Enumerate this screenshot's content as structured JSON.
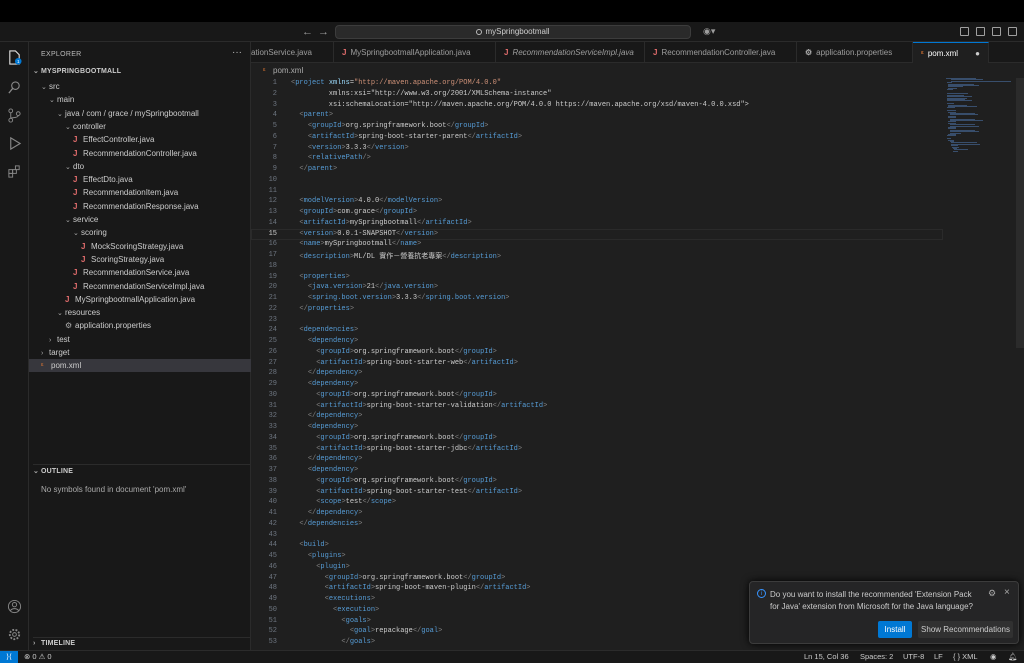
{
  "titlebar": {
    "search": "mySpringbootmall"
  },
  "explorer": {
    "header": "EXPLORER",
    "project": "MYSPRINGBOOTMALL",
    "tree": [
      {
        "label": "src",
        "indent": 1,
        "kind": "folder-open"
      },
      {
        "label": "main",
        "indent": 2,
        "kind": "folder-open"
      },
      {
        "label": "java / com / grace / mySpringbootmall",
        "indent": 3,
        "kind": "folder-open"
      },
      {
        "label": "controller",
        "indent": 4,
        "kind": "folder-open"
      },
      {
        "label": "EffectController.java",
        "indent": 5,
        "kind": "java"
      },
      {
        "label": "RecommendationController.java",
        "indent": 5,
        "kind": "java"
      },
      {
        "label": "dto",
        "indent": 4,
        "kind": "folder-open"
      },
      {
        "label": "EffectDto.java",
        "indent": 5,
        "kind": "java"
      },
      {
        "label": "RecommendationItem.java",
        "indent": 5,
        "kind": "java"
      },
      {
        "label": "RecommendationResponse.java",
        "indent": 5,
        "kind": "java"
      },
      {
        "label": "service",
        "indent": 4,
        "kind": "folder-open"
      },
      {
        "label": "scoring",
        "indent": 5,
        "kind": "folder-open"
      },
      {
        "label": "MockScoringStrategy.java",
        "indent": 6,
        "kind": "java"
      },
      {
        "label": "ScoringStrategy.java",
        "indent": 6,
        "kind": "java"
      },
      {
        "label": "RecommendationService.java",
        "indent": 5,
        "kind": "java"
      },
      {
        "label": "RecommendationServiceImpl.java",
        "indent": 5,
        "kind": "java"
      },
      {
        "label": "MySpringbootmallApplication.java",
        "indent": 4,
        "kind": "java"
      },
      {
        "label": "resources",
        "indent": 3,
        "kind": "folder-open"
      },
      {
        "label": "application.properties",
        "indent": 4,
        "kind": "gear"
      },
      {
        "label": "test",
        "indent": 2,
        "kind": "folder-closed"
      },
      {
        "label": "target",
        "indent": 1,
        "kind": "folder-closed"
      },
      {
        "label": "pom.xml",
        "indent": 1,
        "kind": "xml",
        "selected": true
      }
    ],
    "outline_title": "OUTLINE",
    "outline_msg": "No symbols found in document 'pom.xml'",
    "timeline_title": "TIMELINE"
  },
  "tabs": [
    {
      "label": "ationService.java",
      "icon": "java"
    },
    {
      "label": "MySpringbootmallApplication.java",
      "icon": "java"
    },
    {
      "label": "RecommendationServiceImpl.java",
      "icon": "java",
      "italic": true
    },
    {
      "label": "RecommendationController.java",
      "icon": "java"
    },
    {
      "label": "application.properties",
      "icon": "gear"
    },
    {
      "label": "pom.xml",
      "icon": "xml",
      "active": true
    }
  ],
  "breadcrumb": "pom.xml",
  "code_lines": [
    "<project xmlns=\"http://maven.apache.org/POM/4.0.0\"",
    "         xmlns:xsi=\"http://www.w3.org/2001/XMLSchema-instance\"",
    "         xsi:schemaLocation=\"http://maven.apache.org/POM/4.0.0 https://maven.apache.org/xsd/maven-4.0.0.xsd\">",
    "  <parent>",
    "    <groupId>org.springframework.boot</groupId>",
    "    <artifactId>spring-boot-starter-parent</artifactId>",
    "    <version>3.3.3</version>",
    "    <relativePath/>",
    "  </parent>",
    "",
    "",
    "  <modelVersion>4.0.0</modelVersion>",
    "  <groupId>com.grace</groupId>",
    "  <artifactId>mySpringbootmall</artifactId>",
    "  <version>0.0.1-SNAPSHOT</version>",
    "  <name>mySpringbootmall</name>",
    "  <description>ML/DL 實作－營養抗老專案</description>",
    "",
    "  <properties>",
    "    <java.version>21</java.version>",
    "    <spring.boot.version>3.3.3</spring.boot.version>",
    "  </properties>",
    "",
    "  <dependencies>",
    "    <dependency>",
    "      <groupId>org.springframework.boot</groupId>",
    "      <artifactId>spring-boot-starter-web</artifactId>",
    "    </dependency>",
    "    <dependency>",
    "      <groupId>org.springframework.boot</groupId>",
    "      <artifactId>spring-boot-starter-validation</artifactId>",
    "    </dependency>",
    "    <dependency>",
    "      <groupId>org.springframework.boot</groupId>",
    "      <artifactId>spring-boot-starter-jdbc</artifactId>",
    "    </dependency>",
    "    <dependency>",
    "      <groupId>org.springframework.boot</groupId>",
    "      <artifactId>spring-boot-starter-test</artifactId>",
    "      <scope>test</scope>",
    "    </dependency>",
    "  </dependencies>",
    "",
    "  <build>",
    "    <plugins>",
    "      <plugin>",
    "        <groupId>org.springframework.boot</groupId>",
    "        <artifactId>spring-boot-maven-plugin</artifactId>",
    "        <executions>",
    "          <execution>",
    "            <goals>",
    "              <goal>repackage</goal>",
    "            </goals>"
  ],
  "current_line": 15,
  "notification": {
    "message": "Do you want to install the recommended 'Extension Pack for Java' extension from Microsoft for the Java language?",
    "install": "Install",
    "show": "Show Recommendations"
  },
  "status": {
    "problems": "⊗ 0 ⚠ 0",
    "position": "Ln 15, Col 36",
    "spaces": "Spaces: 2",
    "encoding": "UTF-8",
    "eol": "LF",
    "language": "{ } XML"
  },
  "colors": {
    "accent": "#0078d4",
    "java_icon": "#e06c6c",
    "tag": "#569cd6",
    "attr": "#9cdcfe",
    "string": "#ce9178"
  }
}
